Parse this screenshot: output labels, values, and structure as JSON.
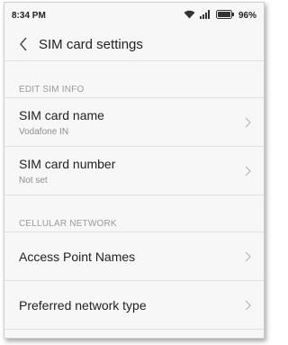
{
  "status_bar": {
    "time": "8:34 PM",
    "battery_percent": "96%",
    "battery_level": 0.96,
    "icons": [
      "wifi-icon",
      "signal-icon",
      "battery-icon"
    ]
  },
  "header": {
    "title": "SIM card settings",
    "back_icon": "chevron-left-icon"
  },
  "sections": [
    {
      "label": "EDIT SIM INFO",
      "items": [
        {
          "title": "SIM card name",
          "subtitle": "Vodafone IN"
        },
        {
          "title": "SIM card number",
          "subtitle": "Not set"
        }
      ]
    },
    {
      "label": "CELLULAR NETWORK",
      "items": [
        {
          "title": "Access Point Names"
        },
        {
          "title": "Preferred network type"
        }
      ]
    }
  ],
  "colors": {
    "background": "#f7f7f7",
    "text_primary": "#222222",
    "text_secondary": "#8e8e8e",
    "section_label": "#9a9a9a",
    "divider": "#e2e2e2",
    "chevron": "#b5b5b5"
  }
}
